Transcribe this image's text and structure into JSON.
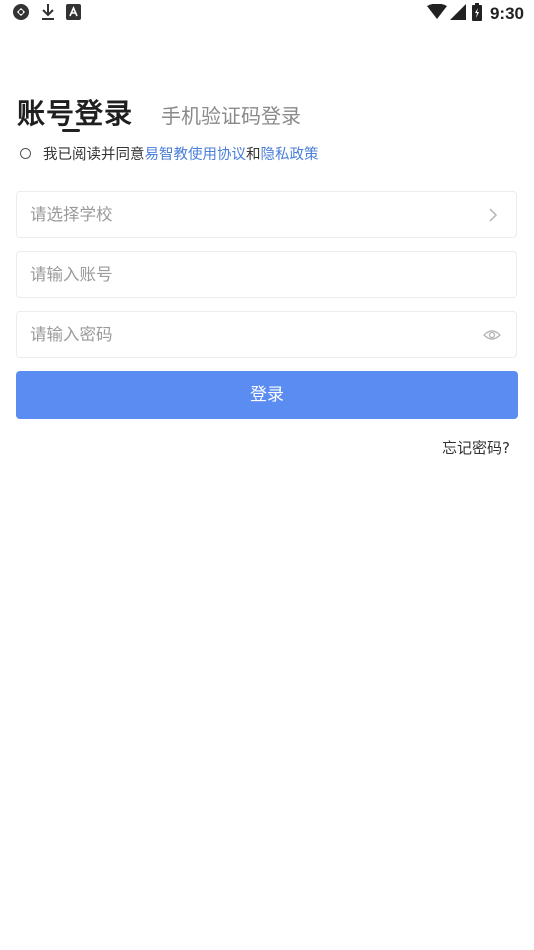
{
  "status_bar": {
    "time": "9:30",
    "icons_left": [
      "sync-icon",
      "download-icon",
      "a-square-icon"
    ],
    "icons_right": [
      "wifi-icon",
      "signal-icon",
      "battery-icon"
    ]
  },
  "tabs": {
    "active": "账号登录",
    "inactive": "手机验证码登录"
  },
  "agreement": {
    "prefix": "我已阅读并同意",
    "terms_link": "易智教使用协议",
    "connector": "和",
    "privacy_link": "隐私政策",
    "checked": false
  },
  "fields": {
    "school_placeholder": "请选择学校",
    "account_placeholder": "请输入账号",
    "password_placeholder": "请输入密码"
  },
  "login_button": "登录",
  "forgot_password": "忘记密码?",
  "colors": {
    "primary": "#5b8cf2",
    "link": "#4a7fd8",
    "placeholder": "#9a9a9a"
  }
}
